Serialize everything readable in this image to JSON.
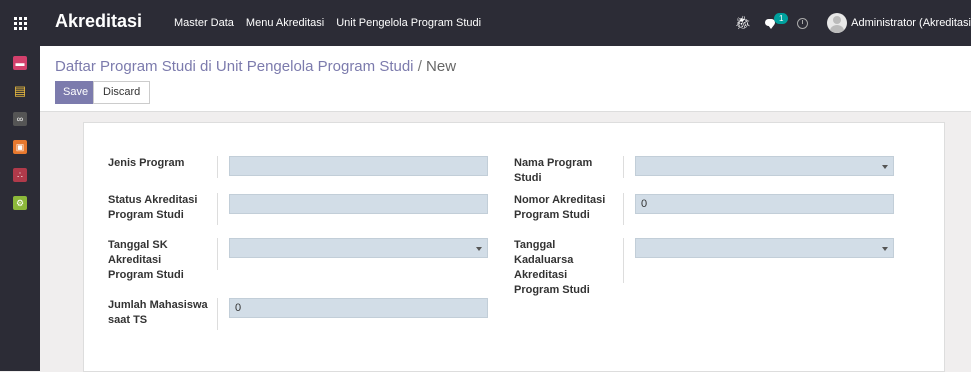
{
  "app": {
    "title": "Akreditasi"
  },
  "menu": {
    "items": [
      "Master Data",
      "Menu Akreditasi",
      "Unit Pengelola Program Studi"
    ]
  },
  "systray": {
    "message_count": "1",
    "user": "Administrator (Akreditasi"
  },
  "breadcrumb": {
    "parent": "Daftar Program Studi di Unit Pengelola Program Studi",
    "separator": "/",
    "current": "New"
  },
  "toolbar": {
    "save_label": "Save",
    "discard_label": "Discard"
  },
  "sidebar": {
    "icons": [
      "discuss-icon",
      "notes-icon",
      "link-icon",
      "document-icon",
      "share-icon",
      "settings-icon"
    ]
  },
  "form": {
    "jenis_program": {
      "label": "Jenis Program",
      "value": ""
    },
    "status_akreditasi": {
      "label": "Status Akreditasi Program Studi",
      "value": ""
    },
    "tanggal_sk": {
      "label": "Tanggal SK Akreditasi Program Studi",
      "value": ""
    },
    "jumlah_mahasiswa": {
      "label": "Jumlah Mahasiswa saat TS",
      "value": "0"
    },
    "nama_program_studi": {
      "label": "Nama Program Studi",
      "value": ""
    },
    "nomor_akreditasi": {
      "label": "Nomor Akreditasi Program Studi",
      "value": "0"
    },
    "tanggal_kadaluarsa": {
      "label": "Tanggal Kadaluarsa Akreditasi Program Studi",
      "value": ""
    }
  },
  "colors": {
    "navbar": "#2c2c36",
    "primary": "#7c7bad",
    "field": "#d2dde7",
    "badge": "#00a09d"
  }
}
